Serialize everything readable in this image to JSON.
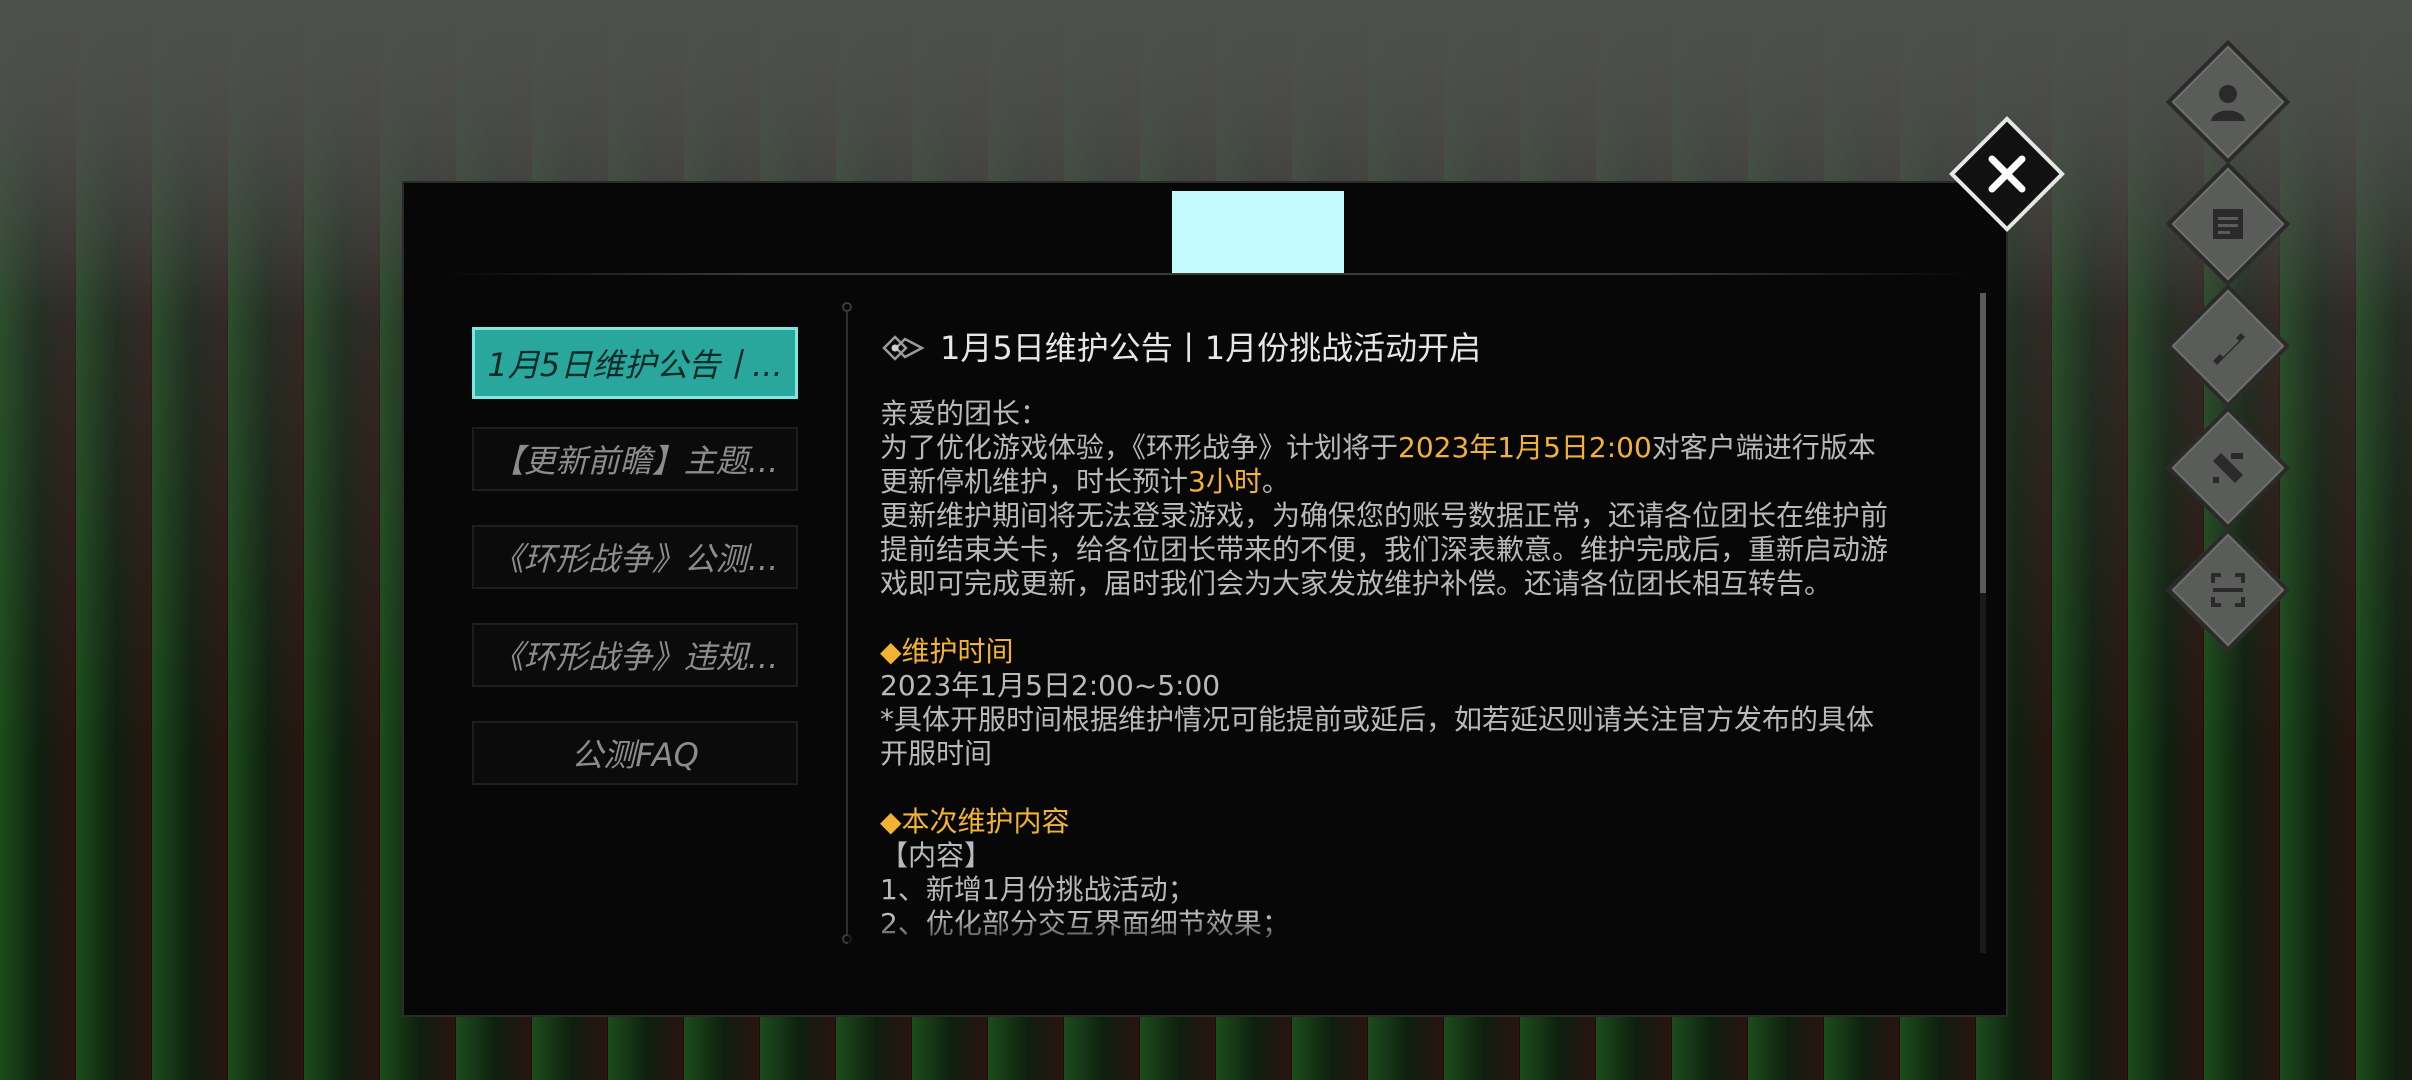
{
  "tabs": [
    {
      "label": "1月5日维护公告丨...",
      "active": true
    },
    {
      "label": "【更新前瞻】主题...",
      "active": false
    },
    {
      "label": "《环形战争》公测...",
      "active": false
    },
    {
      "label": "《环形战争》违规...",
      "active": false
    },
    {
      "label": "公测FAQ",
      "active": false
    }
  ],
  "article": {
    "title": "1月5日维护公告丨1月份挑战活动开启",
    "greeting": "亲爱的团长：",
    "p1_a": "为了优化游戏体验，《环形战争》计划将于",
    "p1_date": "2023年1月5日2:00",
    "p1_b": "对客户端进行版本更新停机维护，时长预计",
    "p1_dur": "3小时",
    "p1_c": "。",
    "p2": "更新维护期间将无法登录游戏，为确保您的账号数据正常，还请各位团长在维护前提前结束关卡，给各位团长带来的不便，我们深表歉意。维护完成后，重新启动游戏即可完成更新，届时我们会为大家发放维护补偿。还请各位团长相互转告。",
    "sec1_title": "◆维护时间",
    "sec1_time": "2023年1月5日2:00~5:00",
    "sec1_note": "*具体开服时间根据维护情况可能提前或延后，如若延迟则请关注官方发布的具体开服时间",
    "sec2_title": "◆本次维护内容",
    "sec2_sub": "【内容】",
    "sec2_item1": "1、新增1月份挑战活动；",
    "sec2_item2": "2、优化部分交互界面细节效果；"
  },
  "colors": {
    "accent": "#2aa79c",
    "highlight": "#f2b233",
    "header_block": "#c3fbff"
  },
  "icons": [
    "profile-icon",
    "notice-icon",
    "banner-icon",
    "tools-icon",
    "scan-icon",
    "close-icon",
    "diamond-bullet-icon"
  ]
}
